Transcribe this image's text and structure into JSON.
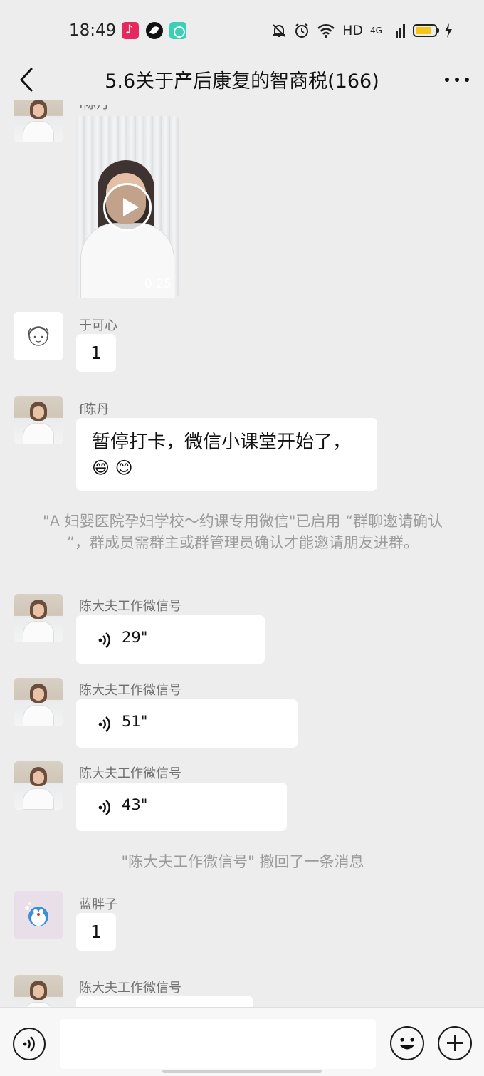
{
  "status_bar": {
    "time": "18:49",
    "network": "HD",
    "cell": "4G",
    "apps": [
      "tiktok-icon",
      "feather-icon",
      "teal-app-icon"
    ],
    "system_icons": [
      "mute-bell-icon",
      "alarm-icon",
      "wifi-icon",
      "signal-icon",
      "battery-icon",
      "charging-icon"
    ]
  },
  "header": {
    "title": "5.6关于产后康复的智商税(166)"
  },
  "messages": [
    {
      "type": "video",
      "sender": "f陈丹",
      "duration": "0:25"
    },
    {
      "type": "text",
      "sender": "于可心",
      "text": "1"
    },
    {
      "type": "text",
      "sender": "f陈丹",
      "text": "暂停打卡，微信小课堂开始了，",
      "emojis": "😄 😊"
    },
    {
      "type": "system",
      "text": "\"A 妇婴医院孕妇学校～约课专用微信\"已启用 “群聊邀请确认 ”，群成员需群主或群管理员确认才能邀请朋友进群。"
    },
    {
      "type": "voice",
      "sender": "陈大夫工作微信号",
      "duration": "29\""
    },
    {
      "type": "voice",
      "sender": "陈大夫工作微信号",
      "duration": "51\""
    },
    {
      "type": "voice",
      "sender": "陈大夫工作微信号",
      "duration": "43\""
    },
    {
      "type": "system",
      "text": "\"陈大夫工作微信号\" 撤回了一条消息"
    },
    {
      "type": "text",
      "sender": "蓝胖子",
      "text": "1"
    },
    {
      "type": "partial",
      "sender": "陈大夫工作微信号"
    }
  ],
  "colors": {
    "background": "#ededed",
    "bubble": "#ffffff",
    "system_text": "#9b9b9b",
    "sender_text": "#6f6f6f"
  }
}
